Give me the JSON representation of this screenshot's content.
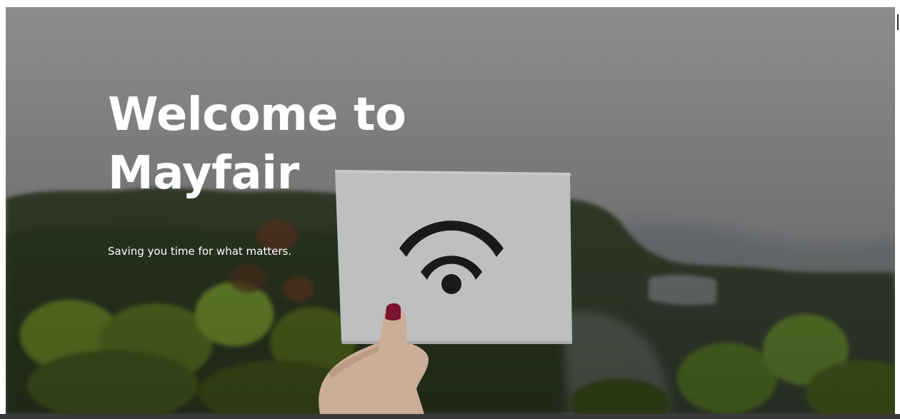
{
  "hero": {
    "heading": "Welcome to Mayfair",
    "tagline": "Saving you time for what matters."
  },
  "icons": {
    "wifi": "wifi-icon"
  },
  "colors": {
    "text": "#ffffff",
    "overlay": "#8f8f8f",
    "paper": "#d9dadc",
    "wifi_glyph": "#1d1d1d"
  }
}
